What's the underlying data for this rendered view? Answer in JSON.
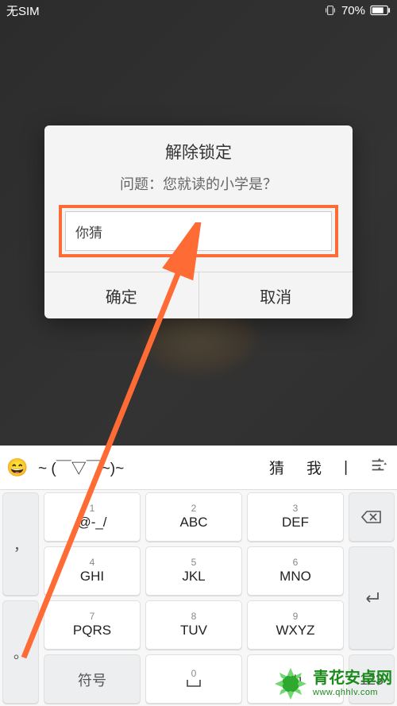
{
  "status": {
    "carrier": "无SIM",
    "battery": "70%"
  },
  "dialog": {
    "title": "解除锁定",
    "question": "问题：您就读的小学是？",
    "input_value": "你猜",
    "ok": "确定",
    "cancel": "取消"
  },
  "suggestions": {
    "kaomoji": "~ (￣▽￣~)~",
    "w1": "猜",
    "w2": "我",
    "w3": "|"
  },
  "keys": {
    "side_dot": "，",
    "side_period": "。",
    "k1n": "1",
    "k1m": "@-_/",
    "k2n": "2",
    "k2m": "ABC",
    "k3n": "3",
    "k3m": "DEF",
    "k4n": "4",
    "k4m": "GHI",
    "k5n": "5",
    "k5m": "JKL",
    "k6n": "6",
    "k6m": "MNO",
    "k7n": "7",
    "k7m": "PQRS",
    "k8n": "8",
    "k8m": "TUV",
    "k9n": "9",
    "k9m": "WXYZ",
    "sym": "符号",
    "k0n": "0",
    "zh": "中",
    "num": "123"
  },
  "watermark": {
    "brand": "青花安卓网",
    "url": "www.qhhlv.com"
  }
}
